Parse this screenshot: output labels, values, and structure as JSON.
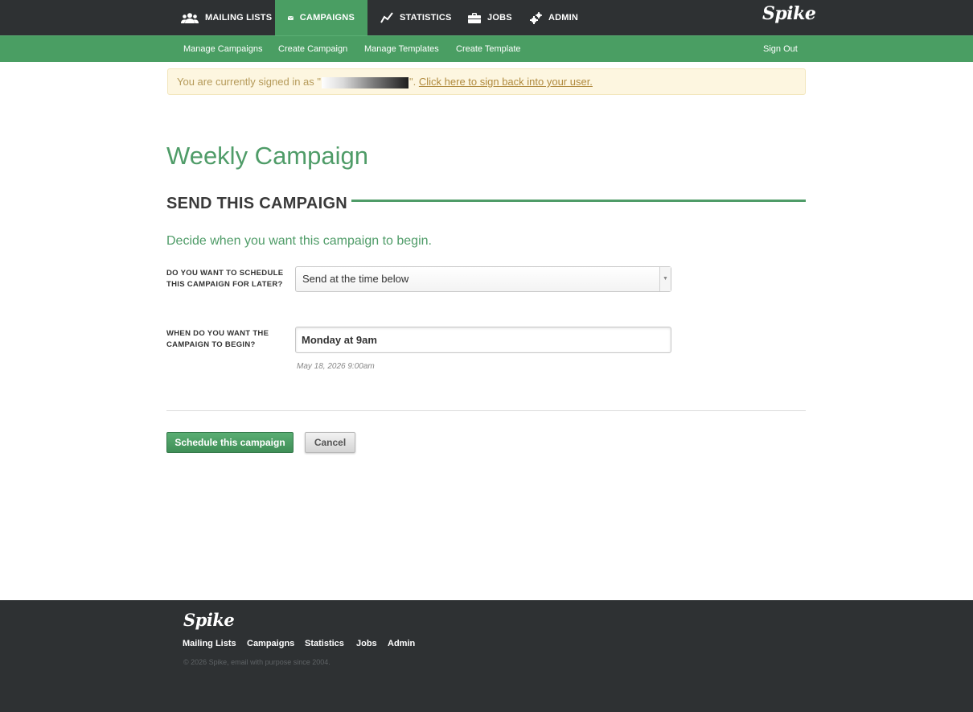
{
  "topnav": {
    "items": [
      {
        "label": "MAILING LISTS",
        "icon": "users-icon",
        "active": false
      },
      {
        "label": "CAMPAIGNS",
        "icon": "envelope-icon",
        "active": true
      },
      {
        "label": "STATISTICS",
        "icon": "line-chart-icon",
        "active": false
      },
      {
        "label": "JOBS",
        "icon": "briefcase-icon",
        "active": false
      },
      {
        "label": "ADMIN",
        "icon": "gears-icon",
        "active": false
      }
    ],
    "logo": "Spike"
  },
  "subnav": {
    "items": [
      "Manage Campaigns",
      "Create Campaign",
      "Manage Templates",
      "Create Template"
    ],
    "sign_out": "Sign Out"
  },
  "alert": {
    "prefix": "You are currently signed in as \"",
    "suffix": "\". ",
    "link": "Click here to sign back into your user."
  },
  "page": {
    "title": "Weekly Campaign",
    "section_title": "SEND THIS CAMPAIGN",
    "intro": "Decide when you want this campaign to begin."
  },
  "form": {
    "schedule_label": "DO YOU WANT TO SCHEDULE THIS CAMPAIGN FOR LATER?",
    "schedule_value": "Send at the time below",
    "begin_label": "WHEN DO YOU WANT THE CAMPAIGN TO BEGIN?",
    "begin_value": "Monday at 9am",
    "begin_hint": "May 18, 2026 9:00am"
  },
  "buttons": {
    "schedule": "Schedule this campaign",
    "cancel": "Cancel"
  },
  "footer": {
    "logo": "Spike",
    "links": [
      "Mailing Lists",
      "Campaigns",
      "Statistics",
      "Jobs",
      "Admin"
    ],
    "copyright": "© 2026 Spike, email with purpose since 2004."
  },
  "colors": {
    "brand_green": "#4a9e63",
    "dark_bar": "#2e3133",
    "alert_bg": "#fdf6e0"
  }
}
